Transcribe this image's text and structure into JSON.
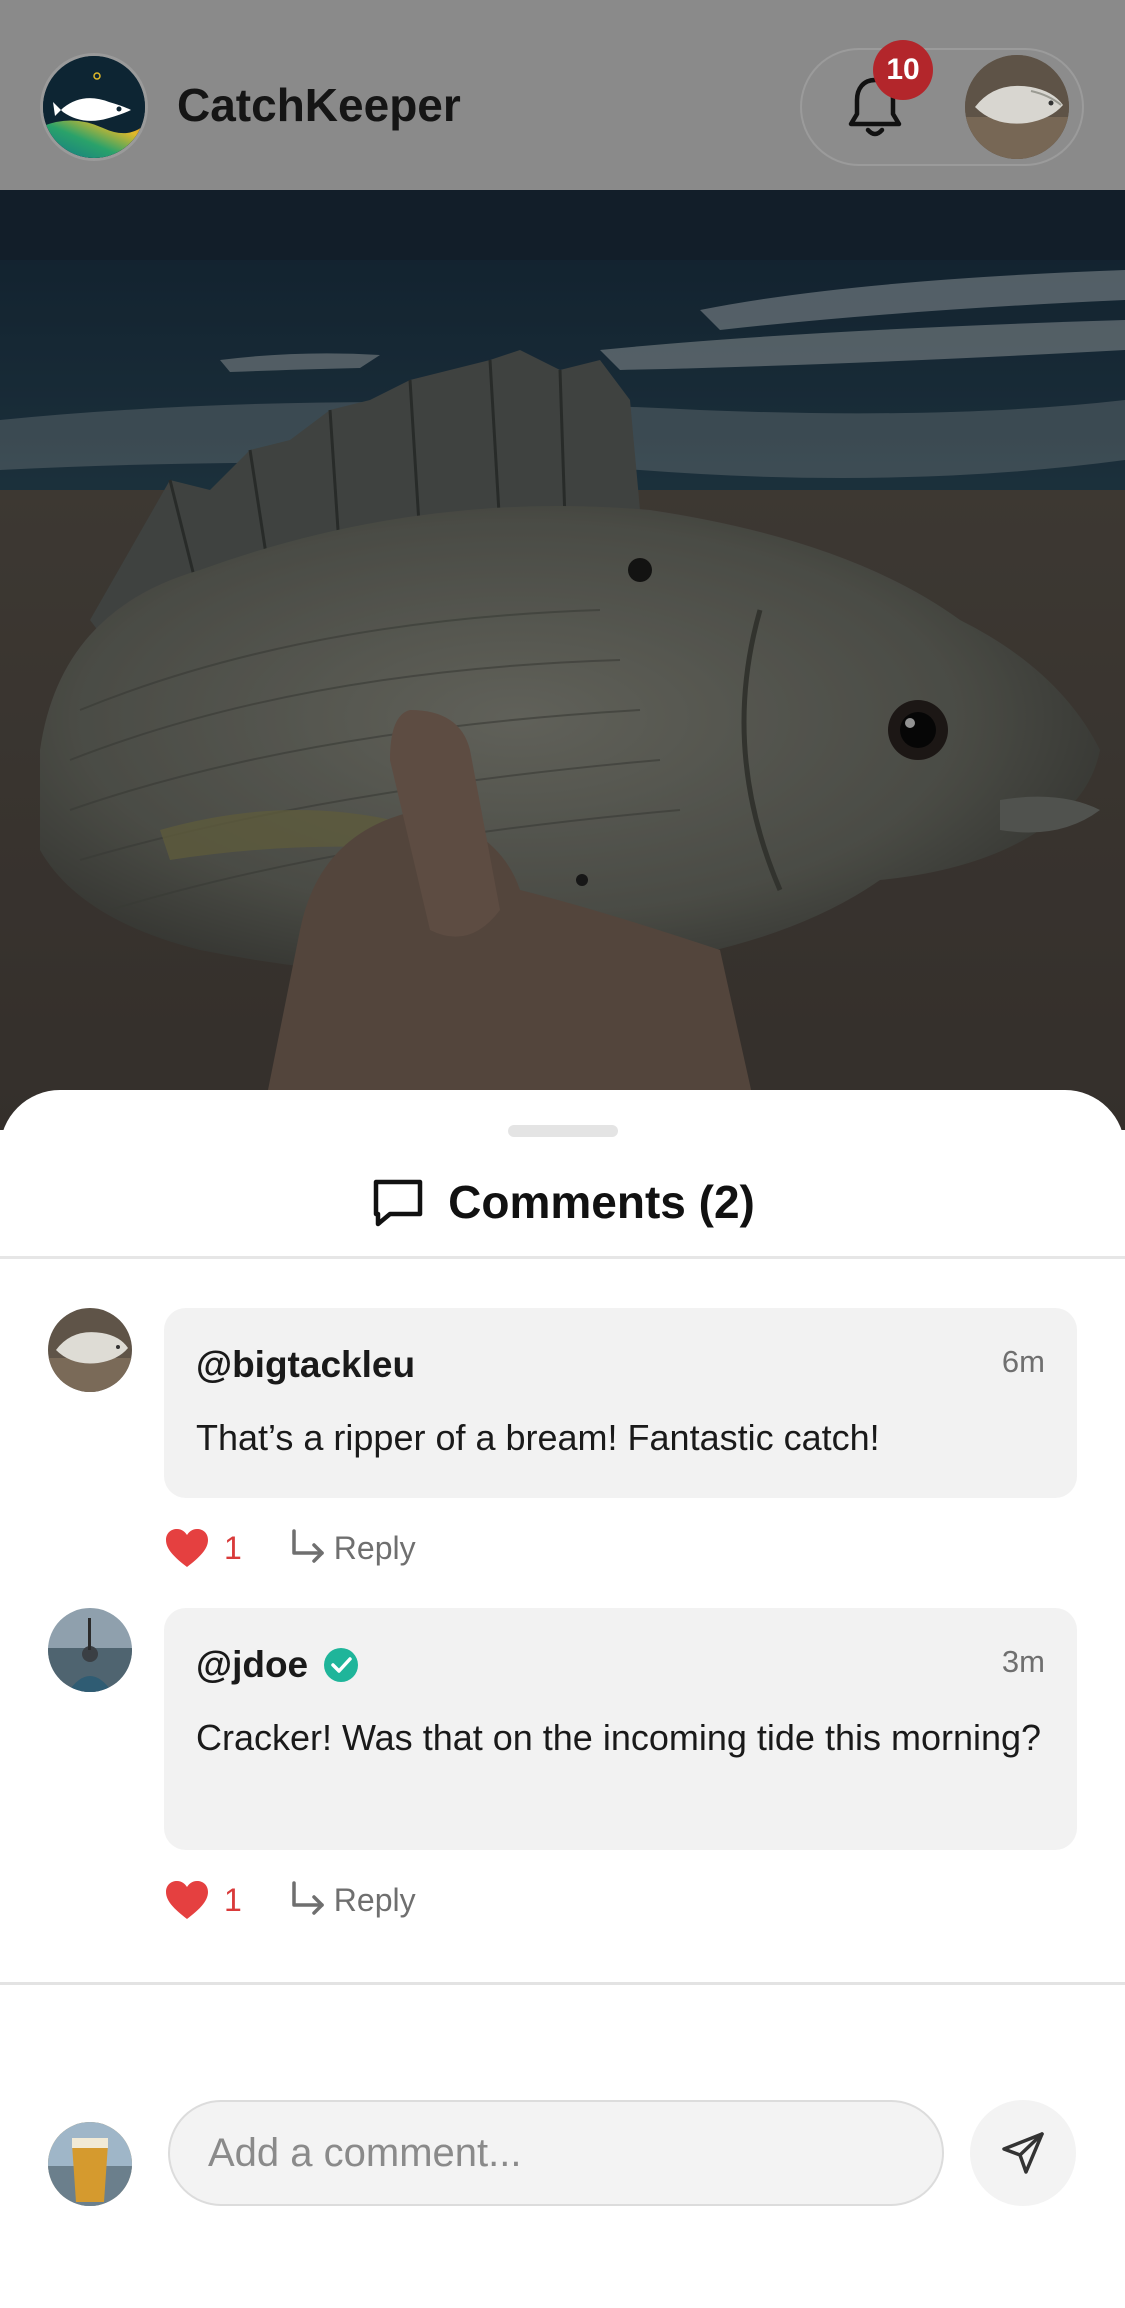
{
  "header": {
    "app_name": "CatchKeeper",
    "notification_count": "10"
  },
  "sheet": {
    "title": "Comments (2)"
  },
  "comments": [
    {
      "username": "@bigtackleu",
      "verified": false,
      "time": "6m",
      "text": "That’s a ripper of a bream! Fantastic catch!",
      "likes": "1",
      "reply_label": "Reply"
    },
    {
      "username": "@jdoe",
      "verified": true,
      "time": "3m",
      "text": "Cracker! Was that on the incoming tide this morning?",
      "likes": "1",
      "reply_label": "Reply"
    }
  ],
  "composer": {
    "placeholder": "Add a comment..."
  },
  "colors": {
    "like": "#d93a3a",
    "verified": "#1fb59a",
    "badge": "#b3262b"
  },
  "icons": [
    "fish-logo-icon",
    "bell-icon",
    "comment-bubble-icon",
    "heart-icon",
    "reply-arrow-icon",
    "verified-check-icon",
    "send-icon"
  ]
}
